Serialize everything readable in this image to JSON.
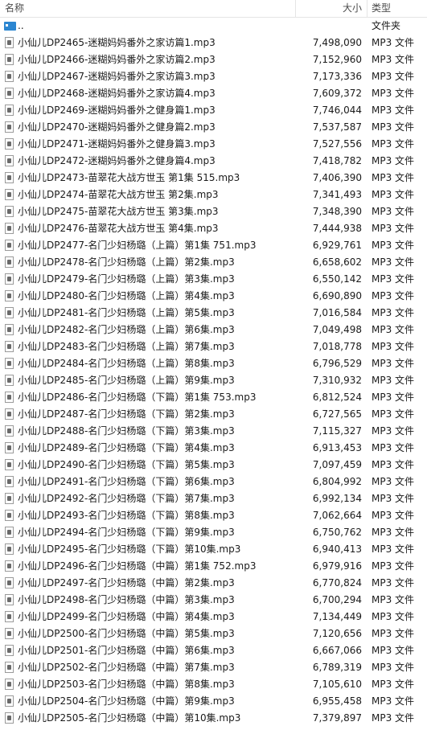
{
  "header": {
    "name": "名称",
    "size": "大小",
    "type": "类型"
  },
  "parent_row": {
    "name": "..",
    "type": "文件夹"
  },
  "files": [
    {
      "name": "小仙儿DP2465-迷糊妈妈番外之家访篇1.mp3",
      "size": "7,498,090",
      "type": "MP3 文件"
    },
    {
      "name": "小仙儿DP2466-迷糊妈妈番外之家访篇2.mp3",
      "size": "7,152,960",
      "type": "MP3 文件"
    },
    {
      "name": "小仙儿DP2467-迷糊妈妈番外之家访篇3.mp3",
      "size": "7,173,336",
      "type": "MP3 文件"
    },
    {
      "name": "小仙儿DP2468-迷糊妈妈番外之家访篇4.mp3",
      "size": "7,609,372",
      "type": "MP3 文件"
    },
    {
      "name": "小仙儿DP2469-迷糊妈妈番外之健身篇1.mp3",
      "size": "7,746,044",
      "type": "MP3 文件"
    },
    {
      "name": "小仙儿DP2470-迷糊妈妈番外之健身篇2.mp3",
      "size": "7,537,587",
      "type": "MP3 文件"
    },
    {
      "name": "小仙儿DP2471-迷糊妈妈番外之健身篇3.mp3",
      "size": "7,527,556",
      "type": "MP3 文件"
    },
    {
      "name": "小仙儿DP2472-迷糊妈妈番外之健身篇4.mp3",
      "size": "7,418,782",
      "type": "MP3 文件"
    },
    {
      "name": "小仙儿DP2473-苗翠花大战方世玉 第1集 515.mp3",
      "size": "7,406,390",
      "type": "MP3 文件"
    },
    {
      "name": "小仙儿DP2474-苗翠花大战方世玉 第2集.mp3",
      "size": "7,341,493",
      "type": "MP3 文件"
    },
    {
      "name": "小仙儿DP2475-苗翠花大战方世玉 第3集.mp3",
      "size": "7,348,390",
      "type": "MP3 文件"
    },
    {
      "name": "小仙儿DP2476-苗翠花大战方世玉 第4集.mp3",
      "size": "7,444,938",
      "type": "MP3 文件"
    },
    {
      "name": "小仙儿DP2477-名门少妇杨璐（上篇）第1集 751.mp3",
      "size": "6,929,761",
      "type": "MP3 文件"
    },
    {
      "name": "小仙儿DP2478-名门少妇杨璐（上篇）第2集.mp3",
      "size": "6,658,602",
      "type": "MP3 文件"
    },
    {
      "name": "小仙儿DP2479-名门少妇杨璐（上篇）第3集.mp3",
      "size": "6,550,142",
      "type": "MP3 文件"
    },
    {
      "name": "小仙儿DP2480-名门少妇杨璐（上篇）第4集.mp3",
      "size": "6,690,890",
      "type": "MP3 文件"
    },
    {
      "name": "小仙儿DP2481-名门少妇杨璐（上篇）第5集.mp3",
      "size": "7,016,584",
      "type": "MP3 文件"
    },
    {
      "name": "小仙儿DP2482-名门少妇杨璐（上篇）第6集.mp3",
      "size": "7,049,498",
      "type": "MP3 文件"
    },
    {
      "name": "小仙儿DP2483-名门少妇杨璐（上篇）第7集.mp3",
      "size": "7,018,778",
      "type": "MP3 文件"
    },
    {
      "name": "小仙儿DP2484-名门少妇杨璐（上篇）第8集.mp3",
      "size": "6,796,529",
      "type": "MP3 文件"
    },
    {
      "name": "小仙儿DP2485-名门少妇杨璐（上篇）第9集.mp3",
      "size": "7,310,932",
      "type": "MP3 文件"
    },
    {
      "name": "小仙儿DP2486-名门少妇杨璐（下篇）第1集 753.mp3",
      "size": "6,812,524",
      "type": "MP3 文件"
    },
    {
      "name": "小仙儿DP2487-名门少妇杨璐（下篇）第2集.mp3",
      "size": "6,727,565",
      "type": "MP3 文件"
    },
    {
      "name": "小仙儿DP2488-名门少妇杨璐（下篇）第3集.mp3",
      "size": "7,115,327",
      "type": "MP3 文件"
    },
    {
      "name": "小仙儿DP2489-名门少妇杨璐（下篇）第4集.mp3",
      "size": "6,913,453",
      "type": "MP3 文件"
    },
    {
      "name": "小仙儿DP2490-名门少妇杨璐（下篇）第5集.mp3",
      "size": "7,097,459",
      "type": "MP3 文件"
    },
    {
      "name": "小仙儿DP2491-名门少妇杨璐（下篇）第6集.mp3",
      "size": "6,804,992",
      "type": "MP3 文件"
    },
    {
      "name": "小仙儿DP2492-名门少妇杨璐（下篇）第7集.mp3",
      "size": "6,992,134",
      "type": "MP3 文件"
    },
    {
      "name": "小仙儿DP2493-名门少妇杨璐（下篇）第8集.mp3",
      "size": "7,062,664",
      "type": "MP3 文件"
    },
    {
      "name": "小仙儿DP2494-名门少妇杨璐（下篇）第9集.mp3",
      "size": "6,750,762",
      "type": "MP3 文件"
    },
    {
      "name": "小仙儿DP2495-名门少妇杨璐（下篇）第10集.mp3",
      "size": "6,940,413",
      "type": "MP3 文件"
    },
    {
      "name": "小仙儿DP2496-名门少妇杨璐（中篇）第1集 752.mp3",
      "size": "6,979,916",
      "type": "MP3 文件"
    },
    {
      "name": "小仙儿DP2497-名门少妇杨璐（中篇）第2集.mp3",
      "size": "6,770,824",
      "type": "MP3 文件"
    },
    {
      "name": "小仙儿DP2498-名门少妇杨璐（中篇）第3集.mp3",
      "size": "6,700,294",
      "type": "MP3 文件"
    },
    {
      "name": "小仙儿DP2499-名门少妇杨璐（中篇）第4集.mp3",
      "size": "7,134,449",
      "type": "MP3 文件"
    },
    {
      "name": "小仙儿DP2500-名门少妇杨璐（中篇）第5集.mp3",
      "size": "7,120,656",
      "type": "MP3 文件"
    },
    {
      "name": "小仙儿DP2501-名门少妇杨璐（中篇）第6集.mp3",
      "size": "6,667,066",
      "type": "MP3 文件"
    },
    {
      "name": "小仙儿DP2502-名门少妇杨璐（中篇）第7集.mp3",
      "size": "6,789,319",
      "type": "MP3 文件"
    },
    {
      "name": "小仙儿DP2503-名门少妇杨璐（中篇）第8集.mp3",
      "size": "7,105,610",
      "type": "MP3 文件"
    },
    {
      "name": "小仙儿DP2504-名门少妇杨璐（中篇）第9集.mp3",
      "size": "6,955,458",
      "type": "MP3 文件"
    },
    {
      "name": "小仙儿DP2505-名门少妇杨璐（中篇）第10集.mp3",
      "size": "7,379,897",
      "type": "MP3 文件"
    }
  ]
}
